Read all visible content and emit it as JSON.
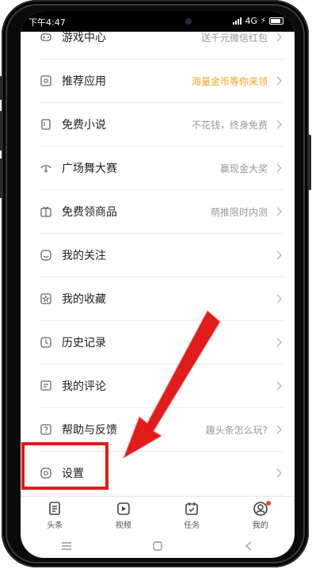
{
  "status": {
    "time": "下午4:47",
    "network": "4G"
  },
  "menu": [
    {
      "label": "游戏中心",
      "sub": "送千元微信红包",
      "sub_style": "gray",
      "icon": "gamepad-icon"
    },
    {
      "label": "推荐应用",
      "sub": "海量金币等你来领",
      "sub_style": "orange",
      "icon": "app-icon"
    },
    {
      "label": "免费小说",
      "sub": "不花钱，终身免费",
      "sub_style": "gray",
      "icon": "book-icon"
    },
    {
      "label": "广场舞大赛",
      "sub": "赢现金大奖",
      "sub_style": "gray",
      "icon": "dance-icon"
    },
    {
      "label": "免费领商品",
      "sub": "萌推限时内测",
      "sub_style": "gray",
      "icon": "gift-icon"
    },
    {
      "label": "我的关注",
      "sub": "",
      "sub_style": "gray",
      "icon": "smile-icon"
    },
    {
      "label": "我的收藏",
      "sub": "",
      "sub_style": "gray",
      "icon": "star-icon"
    },
    {
      "label": "历史记录",
      "sub": "",
      "sub_style": "gray",
      "icon": "clock-icon"
    },
    {
      "label": "我的评论",
      "sub": "",
      "sub_style": "gray",
      "icon": "comment-icon"
    },
    {
      "label": "帮助与反馈",
      "sub": "趣头条怎么玩?",
      "sub_style": "gray",
      "icon": "help-icon"
    },
    {
      "label": "设置",
      "sub": "",
      "sub_style": "gray",
      "icon": "settings-icon"
    }
  ],
  "tabs": [
    {
      "label": "头条",
      "icon": "news-icon"
    },
    {
      "label": "视频",
      "icon": "video-icon"
    },
    {
      "label": "任务",
      "icon": "task-icon"
    },
    {
      "label": "我的",
      "icon": "profile-icon",
      "badge": true
    }
  ],
  "annotation": {
    "color": "#e21b1b"
  }
}
